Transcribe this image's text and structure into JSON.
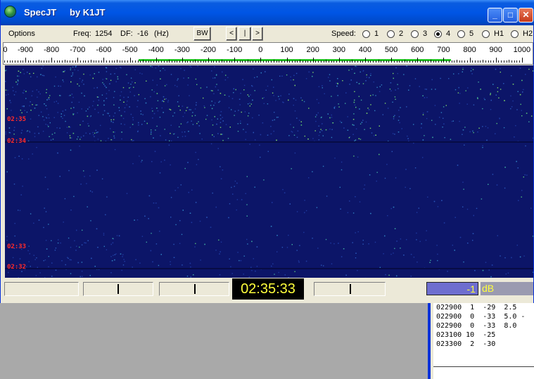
{
  "window": {
    "title": "SpecJT",
    "subtitle": "by K1JT",
    "minimize_label": "_",
    "maximize_label": "□",
    "close_label": "✕"
  },
  "toolbar": {
    "options_label": "Options",
    "freq_label": "Freq:",
    "freq_value": "1254",
    "df_label": "DF:",
    "df_value": "-16",
    "df_unit": "(Hz)",
    "bw_label": "BW",
    "nav_left_label": "<",
    "nav_center_label": "|",
    "nav_right_label": ">",
    "speed_label": "Speed:",
    "speed_options": [
      "1",
      "2",
      "3",
      "4",
      "5",
      "H1",
      "H2"
    ],
    "speed_selected": "4"
  },
  "ruler": {
    "labels": [
      "0",
      "-900",
      "-800",
      "-700",
      "-600",
      "-500",
      "-400",
      "-300",
      "-200",
      "-100",
      "0",
      "100",
      "200",
      "300",
      "400",
      "500",
      "600",
      "700",
      "800",
      "900",
      "1000"
    ]
  },
  "waterfall": {
    "timestamps": [
      "02:35",
      "02:34",
      "02:33",
      "02:32"
    ]
  },
  "status": {
    "clock": "02:35:33",
    "db_value": "-1",
    "db_unit": "dB"
  },
  "decode_list": {
    "rows": [
      "022900  1  -29  2.5",
      "022900  0  -33  5.0 -",
      "022900  0  -33  8.0",
      "023100 10  -25",
      "023300  2  -30"
    ]
  },
  "colors": {
    "titlebar": "#0055e5",
    "waterfall_bg": "#0c1568",
    "clock_text": "#ffff3c",
    "timestamp": "#ff2a2a",
    "tune_bar": "#22c422"
  }
}
